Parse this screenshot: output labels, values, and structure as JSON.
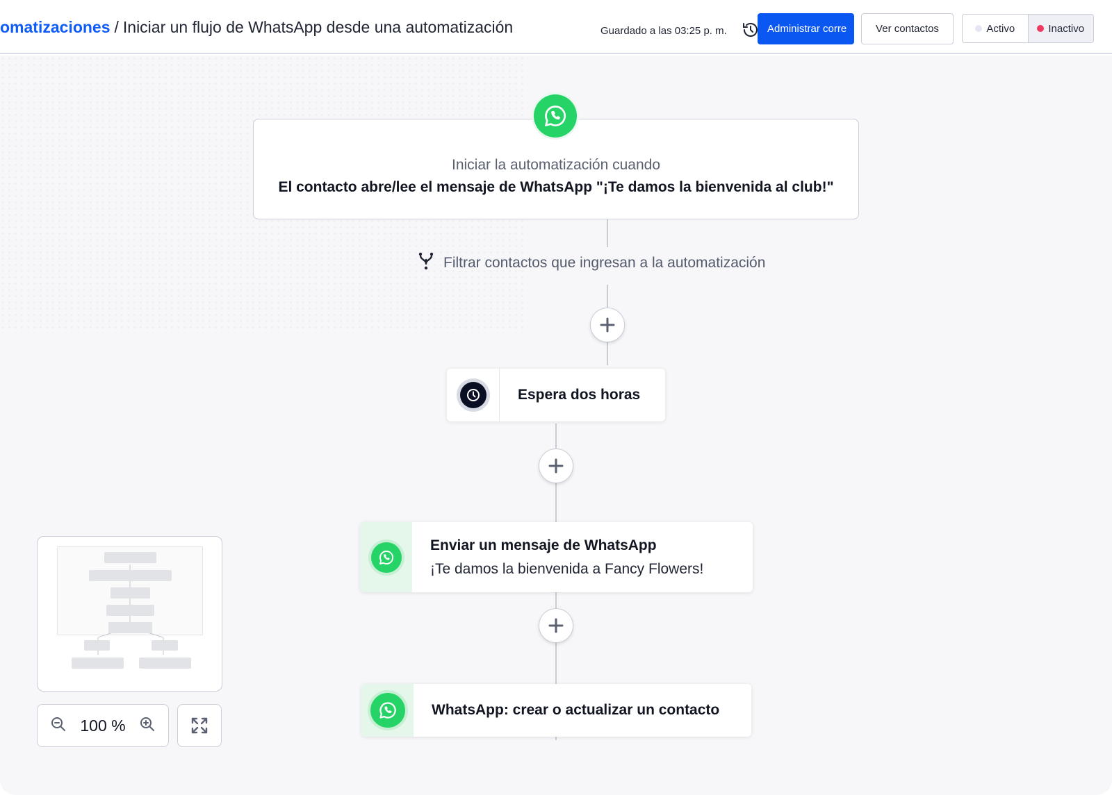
{
  "header": {
    "breadcrumb_link": "omatizaciones",
    "breadcrumb_sep": "/",
    "breadcrumb_current": "Iniciar un flujo de WhatsApp desde una automatización",
    "saved_status": "Guardado a las 03:25 p. m.",
    "manage_button": "Administrar corre",
    "view_contacts_button": "Ver contactos",
    "status_toggle": {
      "active_label": "Activo",
      "inactive_label": "Inactivo",
      "selected": "Inactivo",
      "active_dot_color": "#e4e6f2",
      "inactive_dot_color": "#ee3a62"
    }
  },
  "flow": {
    "trigger": {
      "label": "Iniciar la automatización cuando",
      "text": "El contacto abre/lee el mensaje de WhatsApp \"¡Te damos la bienvenida al club!\"",
      "icon": "whatsapp-icon"
    },
    "filter": {
      "label": "Filtrar contactos que ingresan a la automatización",
      "icon": "filter-branch-icon"
    },
    "steps": [
      {
        "title": "Espera dos horas",
        "icon": "clock-icon"
      },
      {
        "title": "Enviar un mensaje de WhatsApp",
        "subtitle": "¡Te damos la bienvenida a Fancy Flowers!",
        "icon": "whatsapp-icon"
      },
      {
        "title": "WhatsApp: crear o actualizar un contacto",
        "icon": "whatsapp-icon"
      }
    ]
  },
  "zoom": {
    "value": "100 %"
  },
  "colors": {
    "brand_blue": "#0b57f2",
    "whatsapp_green": "#25d366",
    "canvas_bg": "#f7f7f9"
  }
}
